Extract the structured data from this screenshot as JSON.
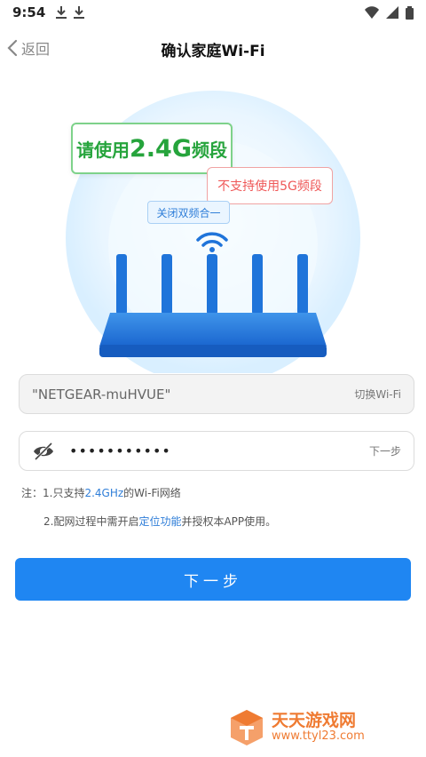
{
  "status_bar": {
    "time": "9:54"
  },
  "header": {
    "back_label": "返回",
    "title": "确认家庭Wi-Fi"
  },
  "hero": {
    "main_badge_prefix": "请使用",
    "main_badge_highlight": "2.4G",
    "main_badge_suffix": "频段",
    "warn_badge": "不支持使用5G频段",
    "tip_badge": "关闭双频合一"
  },
  "ssid_field": {
    "value": "\"NETGEAR-muHVUE\"",
    "action": "切换Wi-Fi"
  },
  "password_field": {
    "value": "•••••••••••",
    "action": "下一步"
  },
  "notes": {
    "note1_prefix": "注：1.只支持",
    "note1_highlight": "2.4GHz",
    "note1_suffix": "的Wi-Fi网络",
    "note2_prefix": "2.配网过程中需开启",
    "note2_highlight": "定位功能",
    "note2_suffix": "并授权本APP使用。"
  },
  "next_button": "下一步",
  "watermark": {
    "title": "天天游戏网",
    "url": "www.ttyl23.com"
  },
  "colors": {
    "accent": "#1f86f2",
    "green": "#26a43c",
    "red": "#ef5858",
    "router_blue": "#1e74d8"
  },
  "icons": [
    "download-icon",
    "wifi-status-icon",
    "signal-icon",
    "battery-icon",
    "back-chevron-icon",
    "eye-off-icon",
    "router-icon",
    "wifi-icon",
    "watermark-logo-icon"
  ]
}
